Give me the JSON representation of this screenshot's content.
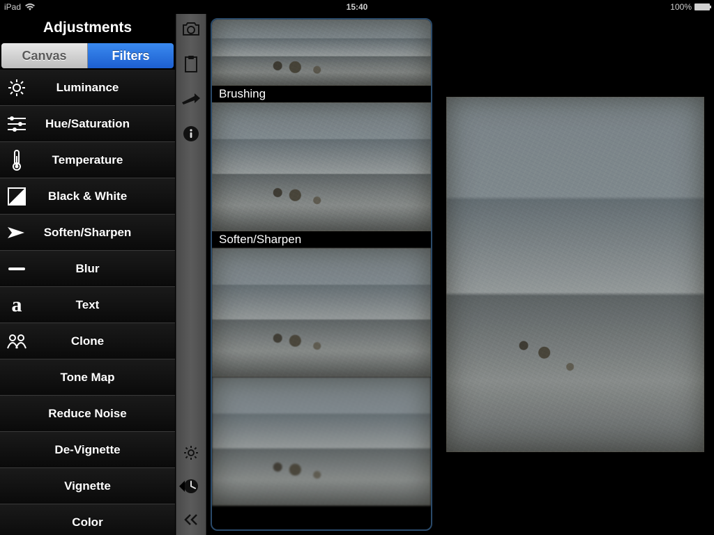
{
  "statusbar": {
    "device": "iPad",
    "time": "15:40",
    "battery_pct": "100%"
  },
  "panel": {
    "title": "Adjustments",
    "tabs": {
      "canvas": "Canvas",
      "filters": "Filters",
      "active": "filters"
    }
  },
  "filters": [
    {
      "id": "luminance",
      "label": "Luminance",
      "icon": "sun"
    },
    {
      "id": "hue-saturation",
      "label": "Hue/Saturation",
      "icon": "sliders"
    },
    {
      "id": "temperature",
      "label": "Temperature",
      "icon": "thermometer"
    },
    {
      "id": "black-white",
      "label": "Black & White",
      "icon": "bw"
    },
    {
      "id": "soften-sharpen",
      "label": "Soften/Sharpen",
      "icon": "arrowhead"
    },
    {
      "id": "blur",
      "label": "Blur",
      "icon": "dash"
    },
    {
      "id": "text",
      "label": "Text",
      "icon": "a"
    },
    {
      "id": "clone",
      "label": "Clone",
      "icon": "clone"
    },
    {
      "id": "tone-map",
      "label": "Tone Map",
      "icon": null
    },
    {
      "id": "reduce-noise",
      "label": "Reduce Noise",
      "icon": null
    },
    {
      "id": "de-vignette",
      "label": "De-Vignette",
      "icon": null
    },
    {
      "id": "vignette",
      "label": "Vignette",
      "icon": null
    },
    {
      "id": "color",
      "label": "Color",
      "icon": null
    }
  ],
  "rail": {
    "top": [
      "camera",
      "clipboard",
      "share",
      "info"
    ],
    "bottom": [
      "gear",
      "history",
      "collapse"
    ]
  },
  "previews": [
    {
      "label": null,
      "size": "small",
      "blur": 0
    },
    {
      "label": "Brushing",
      "size": "large",
      "blur": 0
    },
    {
      "label": "Soften/Sharpen",
      "size": "large",
      "blur": 1
    },
    {
      "label": null,
      "size": "large",
      "blur": 2
    }
  ]
}
